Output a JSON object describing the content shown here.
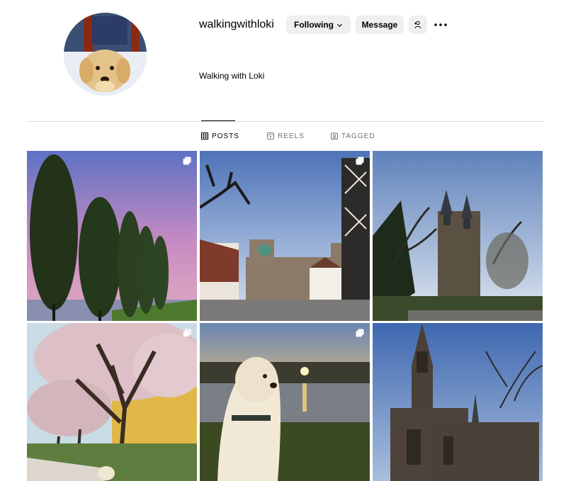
{
  "profile": {
    "username": "walkingwithloki",
    "bio": "Walking with Loki",
    "avatar_icon": "golden-retriever-puppy-photo"
  },
  "actions": {
    "following_label": "Following",
    "message_label": "Message",
    "add_user_icon": "person-plus-icon",
    "more_icon": "ellipsis-icon"
  },
  "tabs": [
    {
      "label": "POSTS",
      "icon": "grid-icon",
      "active": true
    },
    {
      "label": "REELS",
      "icon": "reels-icon",
      "active": false
    },
    {
      "label": "TAGGED",
      "icon": "tagged-icon",
      "active": false
    }
  ],
  "posts": [
    {
      "subject": "poplar trees by river at sunset",
      "multi": true
    },
    {
      "subject": "cathedral and half-timbered house at dusk",
      "multi": true
    },
    {
      "subject": "cathedral with twin spires and bare trees",
      "multi": false
    },
    {
      "subject": "cherry blossom tree with dog",
      "multi": true
    },
    {
      "subject": "golden retriever at sunset by lake",
      "multi": true
    },
    {
      "subject": "gothic church spire",
      "multi": false
    }
  ],
  "colors": {
    "button_bg": "#efefef",
    "divider": "#dbdbdb",
    "tab_inactive": "#737373"
  }
}
